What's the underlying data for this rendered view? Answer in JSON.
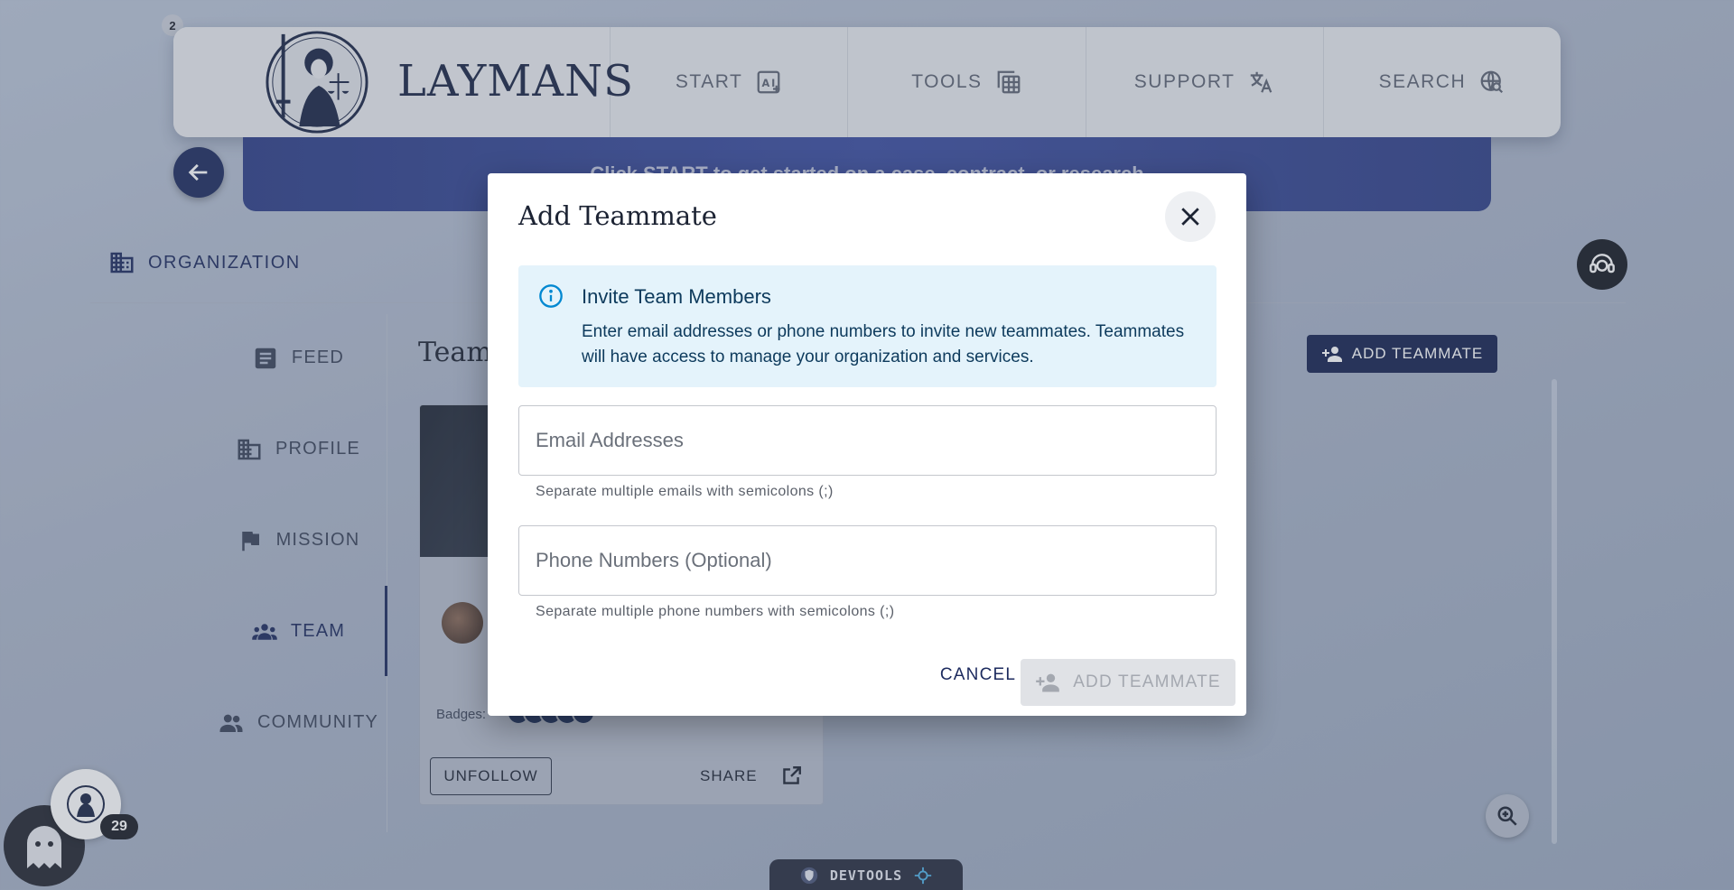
{
  "nav": {
    "tab_count": "2",
    "brand": "LAYMANS",
    "items": [
      {
        "label": "START",
        "icon": "ai-sparkle-icon"
      },
      {
        "label": "TOOLS",
        "icon": "tools-grid-icon"
      },
      {
        "label": "SUPPORT",
        "icon": "translate-icon"
      },
      {
        "label": "SEARCH",
        "icon": "search-globe-icon"
      }
    ]
  },
  "banner": {
    "text": "Click START to get started on a case, contract, or research"
  },
  "org": {
    "label": "ORGANIZATION"
  },
  "sidebar": {
    "items": [
      {
        "label": "FEED"
      },
      {
        "label": "PROFILE"
      },
      {
        "label": "MISSION"
      },
      {
        "label": "TEAM",
        "active": true
      },
      {
        "label": "COMMUNITY"
      }
    ]
  },
  "main": {
    "title": "Team",
    "add_button": "ADD TEAMMATE",
    "card": {
      "badges_label": "Badges:",
      "unfollow": "UNFOLLOW",
      "share": "SHARE"
    }
  },
  "widgets": {
    "count": "29",
    "devtools": "DEVTOOLS"
  },
  "modal": {
    "title": "Add Teammate",
    "alert": {
      "title": "Invite Team Members",
      "body": "Enter email addresses or phone numbers to invite new teammates. Teammates will have access to manage your organization and services."
    },
    "email": {
      "placeholder": "Email Addresses",
      "value": "",
      "helper": "Separate multiple emails with semicolons (;)"
    },
    "phone": {
      "placeholder": "Phone Numbers (Optional)",
      "value": "",
      "helper": "Separate multiple phone numbers with semicolons (;)"
    },
    "cancel": "CANCEL",
    "submit": "ADD TEAMMATE",
    "submit_disabled": true
  },
  "colors": {
    "primary": "#15224f",
    "banner": "#2d3e86",
    "alert_bg": "#e4f3fb",
    "info": "#0288d1",
    "disabled_bg": "#e0e2e6"
  }
}
